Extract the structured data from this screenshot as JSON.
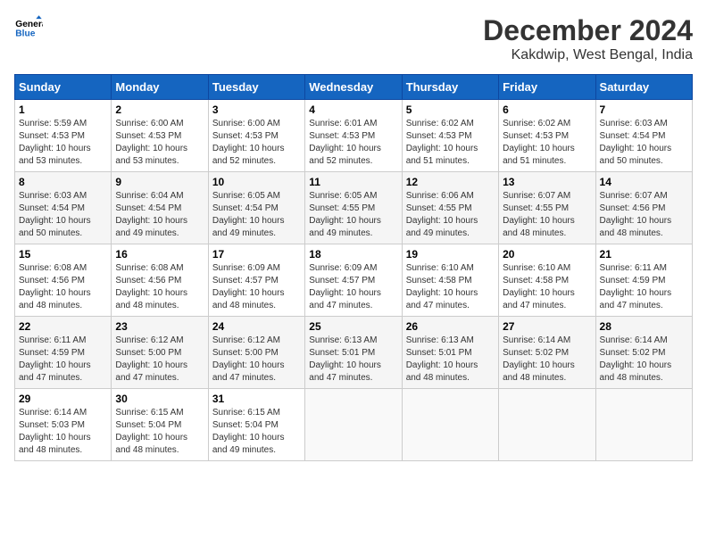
{
  "header": {
    "logo_line1": "General",
    "logo_line2": "Blue",
    "title": "December 2024",
    "subtitle": "Kakdwip, West Bengal, India"
  },
  "calendar": {
    "days_of_week": [
      "Sunday",
      "Monday",
      "Tuesday",
      "Wednesday",
      "Thursday",
      "Friday",
      "Saturday"
    ],
    "weeks": [
      [
        {
          "day": "",
          "info": ""
        },
        {
          "day": "2",
          "info": "Sunrise: 6:00 AM\nSunset: 4:53 PM\nDaylight: 10 hours\nand 53 minutes."
        },
        {
          "day": "3",
          "info": "Sunrise: 6:00 AM\nSunset: 4:53 PM\nDaylight: 10 hours\nand 52 minutes."
        },
        {
          "day": "4",
          "info": "Sunrise: 6:01 AM\nSunset: 4:53 PM\nDaylight: 10 hours\nand 52 minutes."
        },
        {
          "day": "5",
          "info": "Sunrise: 6:02 AM\nSunset: 4:53 PM\nDaylight: 10 hours\nand 51 minutes."
        },
        {
          "day": "6",
          "info": "Sunrise: 6:02 AM\nSunset: 4:53 PM\nDaylight: 10 hours\nand 51 minutes."
        },
        {
          "day": "7",
          "info": "Sunrise: 6:03 AM\nSunset: 4:54 PM\nDaylight: 10 hours\nand 50 minutes."
        }
      ],
      [
        {
          "day": "1",
          "info": "Sunrise: 5:59 AM\nSunset: 4:53 PM\nDaylight: 10 hours\nand 53 minutes."
        },
        {
          "day": "9",
          "info": "Sunrise: 6:04 AM\nSunset: 4:54 PM\nDaylight: 10 hours\nand 49 minutes."
        },
        {
          "day": "10",
          "info": "Sunrise: 6:05 AM\nSunset: 4:54 PM\nDaylight: 10 hours\nand 49 minutes."
        },
        {
          "day": "11",
          "info": "Sunrise: 6:05 AM\nSunset: 4:55 PM\nDaylight: 10 hours\nand 49 minutes."
        },
        {
          "day": "12",
          "info": "Sunrise: 6:06 AM\nSunset: 4:55 PM\nDaylight: 10 hours\nand 49 minutes."
        },
        {
          "day": "13",
          "info": "Sunrise: 6:07 AM\nSunset: 4:55 PM\nDaylight: 10 hours\nand 48 minutes."
        },
        {
          "day": "14",
          "info": "Sunrise: 6:07 AM\nSunset: 4:56 PM\nDaylight: 10 hours\nand 48 minutes."
        }
      ],
      [
        {
          "day": "8",
          "info": "Sunrise: 6:03 AM\nSunset: 4:54 PM\nDaylight: 10 hours\nand 50 minutes."
        },
        {
          "day": "16",
          "info": "Sunrise: 6:08 AM\nSunset: 4:56 PM\nDaylight: 10 hours\nand 48 minutes."
        },
        {
          "day": "17",
          "info": "Sunrise: 6:09 AM\nSunset: 4:57 PM\nDaylight: 10 hours\nand 48 minutes."
        },
        {
          "day": "18",
          "info": "Sunrise: 6:09 AM\nSunset: 4:57 PM\nDaylight: 10 hours\nand 47 minutes."
        },
        {
          "day": "19",
          "info": "Sunrise: 6:10 AM\nSunset: 4:58 PM\nDaylight: 10 hours\nand 47 minutes."
        },
        {
          "day": "20",
          "info": "Sunrise: 6:10 AM\nSunset: 4:58 PM\nDaylight: 10 hours\nand 47 minutes."
        },
        {
          "day": "21",
          "info": "Sunrise: 6:11 AM\nSunset: 4:59 PM\nDaylight: 10 hours\nand 47 minutes."
        }
      ],
      [
        {
          "day": "15",
          "info": "Sunrise: 6:08 AM\nSunset: 4:56 PM\nDaylight: 10 hours\nand 48 minutes."
        },
        {
          "day": "23",
          "info": "Sunrise: 6:12 AM\nSunset: 5:00 PM\nDaylight: 10 hours\nand 47 minutes."
        },
        {
          "day": "24",
          "info": "Sunrise: 6:12 AM\nSunset: 5:00 PM\nDaylight: 10 hours\nand 47 minutes."
        },
        {
          "day": "25",
          "info": "Sunrise: 6:13 AM\nSunset: 5:01 PM\nDaylight: 10 hours\nand 47 minutes."
        },
        {
          "day": "26",
          "info": "Sunrise: 6:13 AM\nSunset: 5:01 PM\nDaylight: 10 hours\nand 48 minutes."
        },
        {
          "day": "27",
          "info": "Sunrise: 6:14 AM\nSunset: 5:02 PM\nDaylight: 10 hours\nand 48 minutes."
        },
        {
          "day": "28",
          "info": "Sunrise: 6:14 AM\nSunset: 5:02 PM\nDaylight: 10 hours\nand 48 minutes."
        }
      ],
      [
        {
          "day": "22",
          "info": "Sunrise: 6:11 AM\nSunset: 4:59 PM\nDaylight: 10 hours\nand 47 minutes."
        },
        {
          "day": "30",
          "info": "Sunrise: 6:15 AM\nSunset: 5:04 PM\nDaylight: 10 hours\nand 48 minutes."
        },
        {
          "day": "31",
          "info": "Sunrise: 6:15 AM\nSunset: 5:04 PM\nDaylight: 10 hours\nand 49 minutes."
        },
        {
          "day": "",
          "info": ""
        },
        {
          "day": "",
          "info": ""
        },
        {
          "day": "",
          "info": ""
        },
        {
          "day": "",
          "info": ""
        }
      ],
      [
        {
          "day": "29",
          "info": "Sunrise: 6:14 AM\nSunset: 5:03 PM\nDaylight: 10 hours\nand 48 minutes."
        },
        {
          "day": "",
          "info": ""
        },
        {
          "day": "",
          "info": ""
        },
        {
          "day": "",
          "info": ""
        },
        {
          "day": "",
          "info": ""
        },
        {
          "day": "",
          "info": ""
        },
        {
          "day": "",
          "info": ""
        }
      ]
    ]
  }
}
